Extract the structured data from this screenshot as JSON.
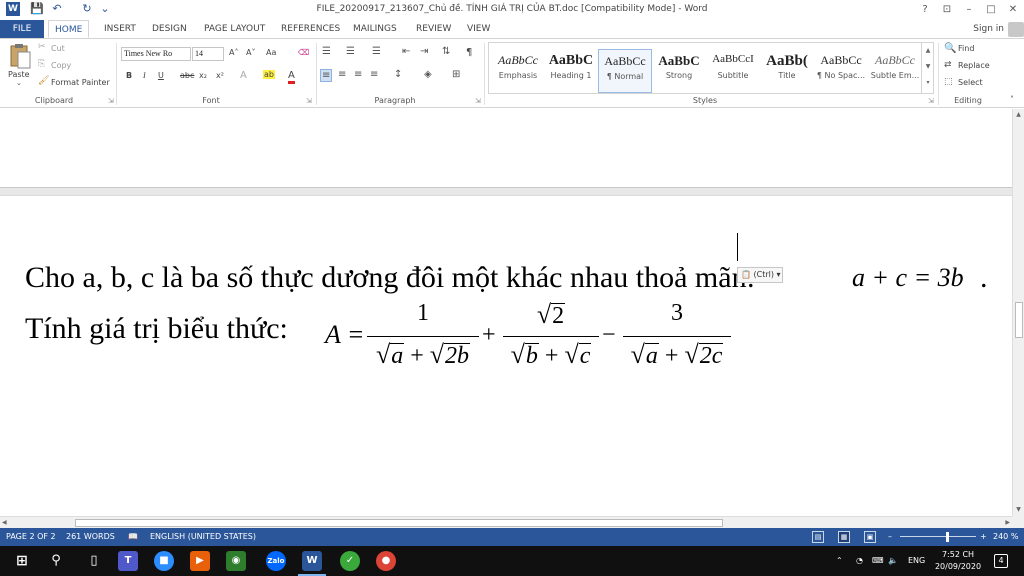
{
  "window": {
    "title": "FILE_20200917_213607_Chủ đề. TÍNH GIÁ TRỊ CỦA BT.doc [Compatibility Mode] - Word",
    "help": "?",
    "restore_ribbon": "⊡",
    "minimize": "–",
    "maximize": "□",
    "close": "✕",
    "word_logo": "W"
  },
  "quick_access": {
    "save": "💾",
    "undo": "↶",
    "redo": "↻",
    "customize": "⌄"
  },
  "tabs": [
    {
      "label": "FILE"
    },
    {
      "label": "HOME"
    },
    {
      "label": "INSERT"
    },
    {
      "label": "DESIGN"
    },
    {
      "label": "PAGE LAYOUT"
    },
    {
      "label": "REFERENCES"
    },
    {
      "label": "MAILINGS"
    },
    {
      "label": "REVIEW"
    },
    {
      "label": "VIEW"
    }
  ],
  "account": {
    "sign_in": "Sign in"
  },
  "ribbon": {
    "clipboard": {
      "label": "Clipboard",
      "paste": "Paste",
      "cut": "Cut",
      "copy": "Copy",
      "format_painter": "Format Painter"
    },
    "font": {
      "label": "Font",
      "font_name": "Times New Ro",
      "font_size": "14",
      "grow": "A˄",
      "shrink": "A˅",
      "change_case": "Aa",
      "clear": "⌫",
      "bold": "B",
      "italic": "I",
      "underline": "U",
      "strike": "abc",
      "subscript": "x₂",
      "superscript": "x²",
      "text_effects": "A",
      "highlight": "ab",
      "font_color": "A"
    },
    "paragraph": {
      "label": "Paragraph",
      "show_marks": "¶"
    },
    "styles": {
      "label": "Styles",
      "items": [
        {
          "sample": "AaBbCc",
          "name": "Emphasis"
        },
        {
          "sample": "AaBbC",
          "name": "Heading 1"
        },
        {
          "sample": "AaBbCc",
          "name": "¶ Normal"
        },
        {
          "sample": "AaBbC",
          "name": "Strong"
        },
        {
          "sample": "AaBbCcI",
          "name": "Subtitle"
        },
        {
          "sample": "AaBb(",
          "name": "Title"
        },
        {
          "sample": "AaBbCc",
          "name": "¶ No Spac..."
        },
        {
          "sample": "AaBbCc",
          "name": "Subtle Em..."
        }
      ]
    },
    "editing": {
      "label": "Editing",
      "find": "Find",
      "replace": "Replace",
      "select": "Select"
    },
    "collapse": "˄"
  },
  "document": {
    "line1_text": "Cho a, b, c là ba số thực dương đôi một khác nhau thoả mãn:",
    "line1_math": "a + c = 3b",
    "line1_end": ".",
    "line2_text": "Tính giá trị biểu thức:",
    "formula": {
      "lhs": "A =",
      "frac1_num": "1",
      "frac1_den_a": "a",
      "frac1_den_b": "2b",
      "plus1": "+",
      "frac2_num": "2",
      "frac2_den_a": "b",
      "frac2_den_b": "c",
      "minus": "−",
      "frac3_num": "3",
      "frac3_den_a": "a",
      "frac3_den_b": "2c",
      "plus_inner": "+"
    },
    "paste_options": "(Ctrl)"
  },
  "status": {
    "page": "PAGE 2 OF 2",
    "words": "261 WORDS",
    "language": "ENGLISH (UNITED STATES)",
    "zoom": "240 %",
    "zoom_minus": "–",
    "zoom_plus": "+"
  },
  "taskbar": {
    "word_label": "W",
    "zalo_label": "Zalo",
    "language": "ENG",
    "time": "7:52 CH",
    "date": "20/09/2020",
    "notifications": "4"
  },
  "colors": {
    "accent": "#2b579a",
    "taskbar": "#101010"
  }
}
